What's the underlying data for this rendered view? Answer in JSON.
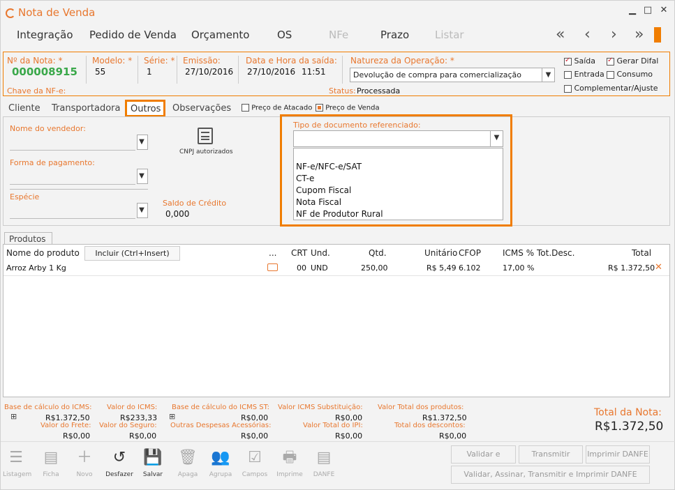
{
  "window": {
    "title": "Nota de Venda",
    "minimize": "▁",
    "maximize": "□",
    "close": "✕"
  },
  "menu": {
    "integracao": "Integração",
    "pedido": "Pedido de Venda",
    "orcamento": "Orçamento",
    "os": "OS",
    "nfe": "NFe",
    "prazo": "Prazo",
    "listar": "Listar"
  },
  "nav": {
    "first": "«",
    "prev": "‹",
    "next": "›",
    "last": "»"
  },
  "header": {
    "nota_label": "Nº da Nota: *",
    "nota_value": "000008915",
    "modelo_label": "Modelo: *",
    "modelo_value": "55",
    "serie_label": "Série: *",
    "serie_value": "1",
    "emissao_label": "Emissão:",
    "emissao_value": "27/10/2016",
    "saida_label": "Data e Hora da saída:",
    "saida_date": "27/10/2016",
    "saida_time": "11:51",
    "natureza_label": "Natureza da Operação: *",
    "natureza_value": "Devolução de compra para comercialização",
    "chave_label": "Chave da NF-e:",
    "status_label": "Status:",
    "status_value": "Processada",
    "opt_saida": "Saída",
    "opt_entrada": "Entrada",
    "opt_difal": "Gerar Difal",
    "opt_consumo": "Consumo",
    "opt_complementar": "Complementar/Ajuste"
  },
  "tabs": {
    "cliente": "Cliente",
    "transportadora": "Transportadora",
    "outros": "Outros",
    "observacoes": "Observações",
    "preco_atacado": "Preço de Atacado",
    "preco_venda": "Preço de Venda"
  },
  "outros": {
    "vendedor_label": "Nome do vendedor:",
    "pagamento_label": "Forma de pagamento:",
    "especie_label": "Espécie",
    "cnpj_label": "CNPJ autorizados",
    "saldo_label": "Saldo de Crédito",
    "saldo_value": "0,000",
    "tipo_doc_label": "Tipo de documento referenciado:",
    "tipo_doc_options": [
      "NF-e/NFC-e/SAT",
      "CT-e",
      "Cupom Fiscal",
      "Nota Fiscal",
      "NF de Produtor Rural"
    ]
  },
  "produtos": {
    "tab": "Produtos",
    "incluir": "Incluir (Ctrl+Insert)",
    "columns": {
      "nome": "Nome do produto",
      "dots": "...",
      "crt": "CRT",
      "und": "Und.",
      "qtd": "Qtd.",
      "unitario": "Unitário",
      "cfop": "CFOP",
      "icms": "ICMS %",
      "totdesc": "Tot.Desc.",
      "total": "Total"
    },
    "rows": [
      {
        "nome": "Arroz Arby 1 Kg",
        "crt": "00",
        "und": "UND",
        "qtd": "250,00",
        "unitario": "R$ 5,49",
        "cfop": "6.102",
        "icms": "17,00 %",
        "total": "R$ 1.372,50"
      }
    ]
  },
  "totais": {
    "base_icms_l": "Base de cálculo do ICMS:",
    "base_icms_v": "R$1.372,50",
    "valor_icms_l": "Valor do ICMS:",
    "valor_icms_v": "R$233,33",
    "base_st_l": "Base de cálculo do ICMS ST:",
    "base_st_v": "R$0,00",
    "icms_sub_l": "Valor ICMS Substituição:",
    "icms_sub_v": "R$0,00",
    "total_prod_l": "Valor Total dos produtos:",
    "total_prod_v": "R$1.372,50",
    "frete_l": "Valor do Frete:",
    "frete_v": "R$0,00",
    "seguro_l": "Valor do Seguro:",
    "seguro_v": "R$0,00",
    "outras_l": "Outras Despesas Acessórias:",
    "outras_v": "R$0,00",
    "ipi_l": "Valor Total do IPI:",
    "ipi_v": "R$0,00",
    "descontos_l": "Total dos descontos:",
    "descontos_v": "R$0,00",
    "total_nota_l": "Total da Nota:",
    "total_nota_v": "R$1.372,50"
  },
  "toolbar": {
    "listagem": "Listagem",
    "ficha": "Ficha",
    "novo": "Novo",
    "desfazer": "Desfazer",
    "salvar": "Salvar",
    "apaga": "Apaga",
    "agrupa": "Agrupa",
    "campos": "Campos",
    "imprime": "Imprime",
    "danfe": "DANFE",
    "validar": "Validar e Assinar",
    "transmitir": "Transmitir",
    "imprimir_danfe": "Imprimir DANFE",
    "tudo": "Validar, Assinar, Transmitir e Imprimir DANFE"
  }
}
